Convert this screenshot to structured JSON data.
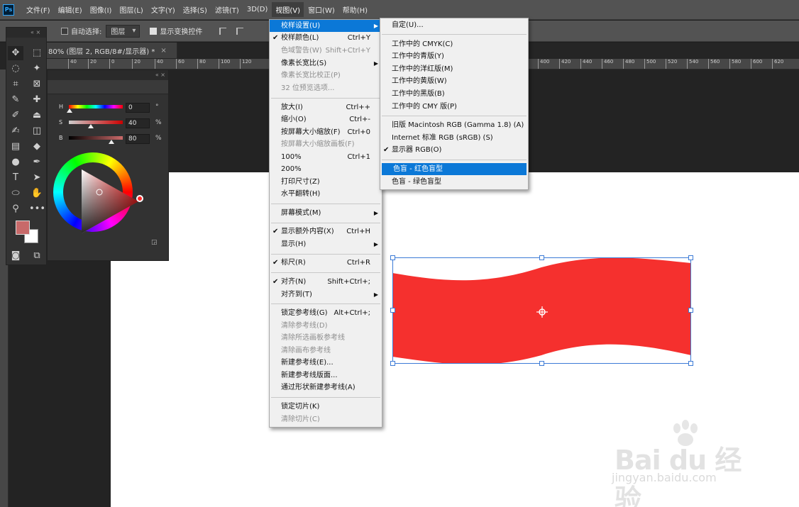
{
  "app": {
    "logo": "Ps"
  },
  "menubar": {
    "items": [
      "文件(F)",
      "编辑(E)",
      "图像(I)",
      "图层(L)",
      "文字(Y)",
      "选择(S)",
      "滤镜(T)",
      "3D(D)",
      "视图(V)",
      "窗口(W)",
      "帮助(H)"
    ],
    "active": "视图(V)"
  },
  "options": {
    "auto_select_label": "自动选择:",
    "auto_select_checked": false,
    "layer_select_value": "图层",
    "show_transform_label": "显示变换控件",
    "show_transform_checked": true
  },
  "document": {
    "tab_title": "80% (图层 2, RGB/8#/显示器) *",
    "tab_close": "×"
  },
  "ruler": {
    "ticks": [
      "40",
      "20",
      "0",
      "20",
      "40",
      "60",
      "80",
      "100",
      "120",
      "400",
      "420",
      "440",
      "460",
      "480",
      "500",
      "520",
      "540",
      "560",
      "580",
      "600",
      "620"
    ]
  },
  "color_panel": {
    "h_label": "H",
    "h_value": "0",
    "h_unit": "°",
    "s_label": "S",
    "s_value": "40",
    "s_unit": "%",
    "b_label": "B",
    "b_value": "80",
    "b_unit": "%",
    "foreground_color": "#c86a6a",
    "background_color": "#ffffff"
  },
  "view_menu": {
    "items": [
      {
        "label": "校样设置(U)",
        "shortcut": "",
        "submenu": true,
        "checked": false,
        "disabled": false,
        "highlight": true
      },
      {
        "label": "校样颜色(L)",
        "shortcut": "Ctrl+Y",
        "checked": true
      },
      {
        "label": "色域警告(W)",
        "shortcut": "Shift+Ctrl+Y",
        "disabled": true
      },
      {
        "label": "像素长宽比(S)",
        "submenu": true
      },
      {
        "label": "像素长宽比校正(P)",
        "disabled": true
      },
      {
        "label": "32 位预览选项...",
        "disabled": true
      },
      {
        "label": "放大(I)",
        "shortcut": "Ctrl++"
      },
      {
        "label": "缩小(O)",
        "shortcut": "Ctrl+-"
      },
      {
        "label": "按屏幕大小缩放(F)",
        "shortcut": "Ctrl+0"
      },
      {
        "label": "按屏幕大小缩放画板(F)",
        "disabled": true
      },
      {
        "label": "100%",
        "shortcut": "Ctrl+1"
      },
      {
        "label": "200%"
      },
      {
        "label": "打印尺寸(Z)"
      },
      {
        "label": "水平翻转(H)"
      },
      {
        "label": "屏幕模式(M)",
        "submenu": true
      },
      {
        "label": "显示额外内容(X)",
        "shortcut": "Ctrl+H",
        "checked": true
      },
      {
        "label": "显示(H)",
        "submenu": true
      },
      {
        "label": "标尺(R)",
        "shortcut": "Ctrl+R",
        "checked": true
      },
      {
        "label": "对齐(N)",
        "shortcut": "Shift+Ctrl+;",
        "checked": true
      },
      {
        "label": "对齐到(T)",
        "submenu": true
      },
      {
        "label": "锁定参考线(G)",
        "shortcut": "Alt+Ctrl+;"
      },
      {
        "label": "清除参考线(D)",
        "disabled": true
      },
      {
        "label": "清除所选画板参考线",
        "disabled": true
      },
      {
        "label": "清除画布参考线",
        "disabled": true
      },
      {
        "label": "新建参考线(E)..."
      },
      {
        "label": "新建参考线版面..."
      },
      {
        "label": "通过形状新建参考线(A)"
      },
      {
        "label": "锁定切片(K)"
      },
      {
        "label": "清除切片(C)",
        "disabled": true
      }
    ]
  },
  "proof_submenu": {
    "items": [
      {
        "label": "自定(U)..."
      },
      {
        "label": "工作中的 CMYK(C)"
      },
      {
        "label": "工作中的青版(Y)"
      },
      {
        "label": "工作中的洋红版(M)"
      },
      {
        "label": "工作中的黄版(W)"
      },
      {
        "label": "工作中的黑版(B)"
      },
      {
        "label": "工作中的 CMY 版(P)"
      },
      {
        "label": "旧版 Macintosh RGB (Gamma 1.8) (A)"
      },
      {
        "label": "Internet 标准 RGB (sRGB) (S)"
      },
      {
        "label": "显示器 RGB(O)",
        "checked": true
      },
      {
        "label": "色盲 - 红色盲型",
        "highlight": true
      },
      {
        "label": "色盲 - 绿色盲型"
      }
    ]
  },
  "canvas": {
    "shape_color": "#f5302e"
  },
  "watermark": {
    "brand": "Bai du 经验",
    "url": "jingyan.baidu.com"
  }
}
